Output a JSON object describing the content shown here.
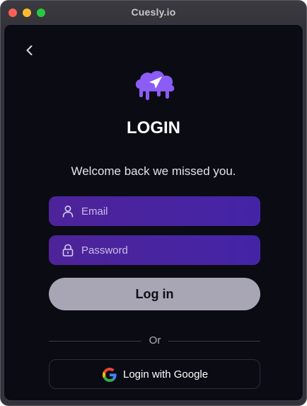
{
  "window": {
    "title": "Cuesly.io"
  },
  "login": {
    "heading": "LOGIN",
    "subtitle": "Welcome back we missed you.",
    "email_placeholder": "Email",
    "email_value": "",
    "password_placeholder": "Password",
    "password_value": "",
    "login_button": "Log in",
    "divider_text": "Or",
    "google_button": "Login with Google"
  },
  "icons": {
    "back": "chevron-left-icon",
    "logo": "cloud-send-logo",
    "email": "user-icon",
    "password": "lock-icon",
    "google": "google-g-logo"
  },
  "colors": {
    "background": "#0b0b13",
    "accent": "#8b5cf6",
    "field": "#4a2aa0",
    "button": "#a8a6b4"
  }
}
